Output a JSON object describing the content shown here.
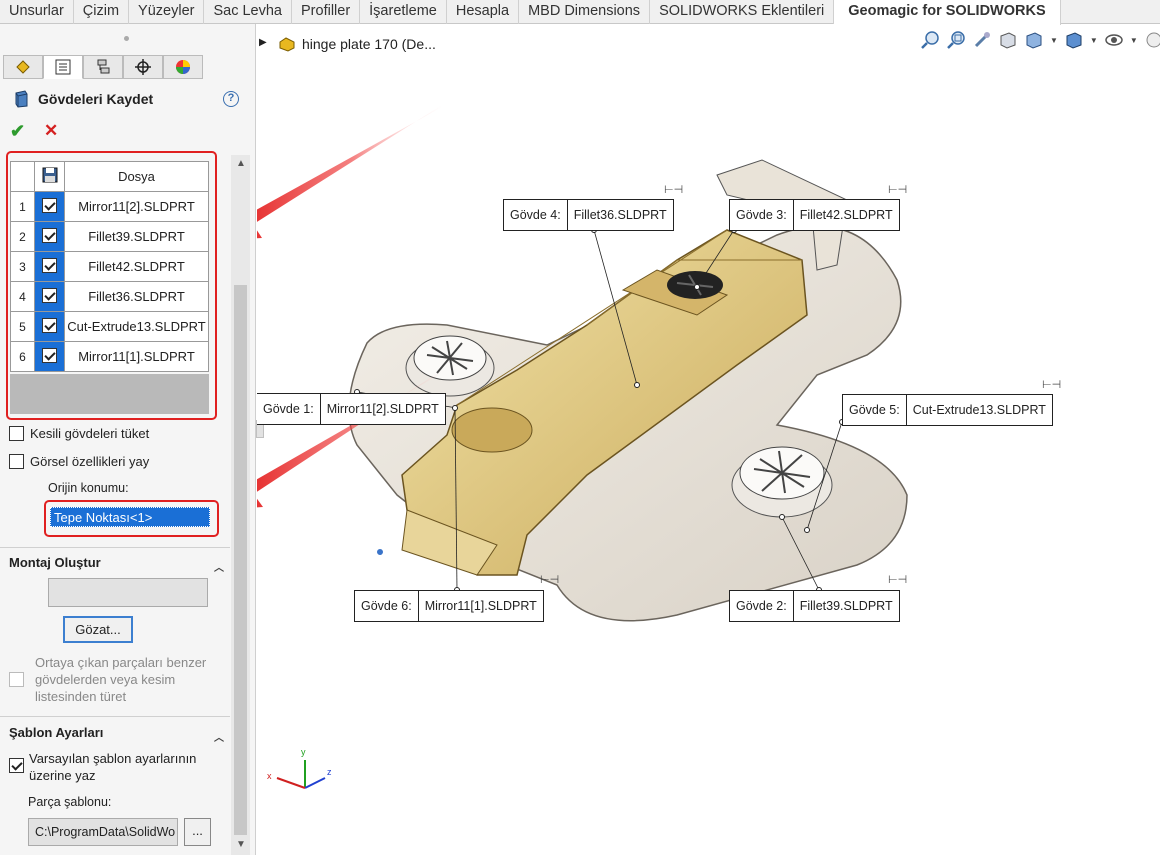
{
  "tabs": [
    "Unsurlar",
    "Çizim",
    "Yüzeyler",
    "Sac Levha",
    "Profiller",
    "İşaretleme",
    "Hesapla",
    "MBD Dimensions",
    "SOLIDWORKS Eklentileri",
    "Geomagic for SOLIDWORKS"
  ],
  "panel": {
    "title": "Gövdeleri Kaydet",
    "help": "?",
    "table_header": "Dosya",
    "rows": [
      {
        "n": "1",
        "file": "Mirror11[2].SLDPRT"
      },
      {
        "n": "2",
        "file": "Fillet39.SLDPRT"
      },
      {
        "n": "3",
        "file": "Fillet42.SLDPRT"
      },
      {
        "n": "4",
        "file": "Fillet36.SLDPRT"
      },
      {
        "n": "5",
        "file": "Cut-Extrude13.SLDPRT"
      },
      {
        "n": "6",
        "file": "Mirror11[1].SLDPRT"
      }
    ],
    "opt_consume": "Kesili gövdeleri tüket",
    "opt_visual": "Görsel özellikleri yay",
    "origin_label": "Orijin konumu:",
    "origin_value": "Tepe Noktası<1>",
    "assembly_section": "Montaj Oluştur",
    "browse": "Gözat...",
    "derive_l1": "Ortaya çıkan parçaları benzer",
    "derive_l2": "gövdelerden veya kesim",
    "derive_l3": "listesinden türet",
    "template_section": "Şablon Ayarları",
    "override_l1": "Varsayılan şablon ayarlarının",
    "override_l2": "üzerine yaz",
    "part_template_label": "Parça şablonu:",
    "part_template_value": "C:\\ProgramData\\SolidWo",
    "dots": "..."
  },
  "tree": {
    "label": "hinge plate 170  (De..."
  },
  "callouts": [
    {
      "k": "Gövde  4:",
      "v": "Fillet36.SLDPRT"
    },
    {
      "k": "Gövde  3:",
      "v": "Fillet42.SLDPRT"
    },
    {
      "k": "Gövde  1:",
      "v": "Mirror11[2].SLDPRT"
    },
    {
      "k": "Gövde  5:",
      "v": "Cut-Extrude13.SLDPRT"
    },
    {
      "k": "Gövde  6:",
      "v": "Mirror11[1].SLDPRT"
    },
    {
      "k": "Gövde  2:",
      "v": "Fillet39.SLDPRT"
    }
  ],
  "triad": {
    "x": "x",
    "y": "y",
    "z": "z"
  },
  "colors": {
    "accent": "#1a6fd6",
    "highlight": "#e02020",
    "brass": "#d8b96a"
  }
}
